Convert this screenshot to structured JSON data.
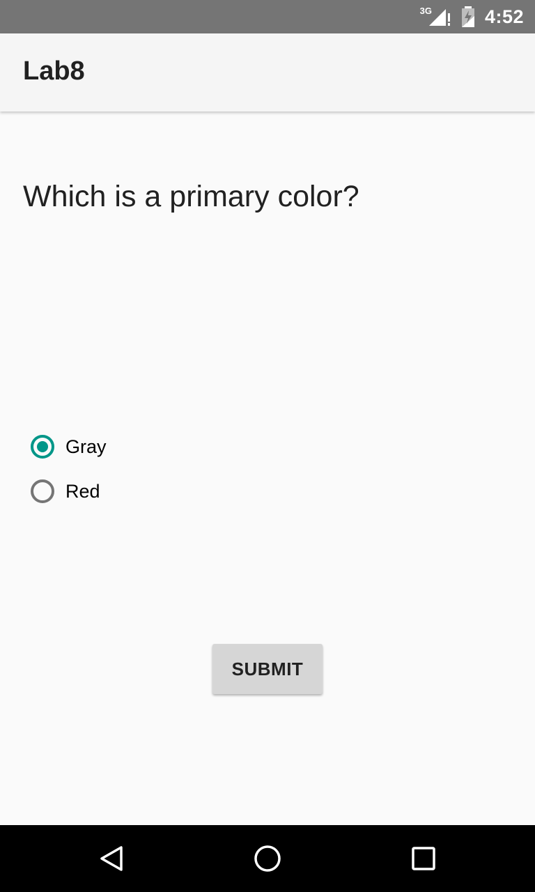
{
  "status_bar": {
    "network": "3G",
    "time": "4:52",
    "icons": [
      "signal-icon",
      "battery-icon"
    ]
  },
  "app_bar": {
    "title": "Lab8"
  },
  "quiz": {
    "question": "Which is a primary color?",
    "options": [
      {
        "label": "Gray",
        "checked": true
      },
      {
        "label": "Red",
        "checked": false
      }
    ],
    "accent_color": "#009688",
    "submit_label": "SUBMIT"
  },
  "nav_bar": {
    "buttons": [
      "back-icon",
      "home-icon",
      "recents-icon"
    ]
  }
}
